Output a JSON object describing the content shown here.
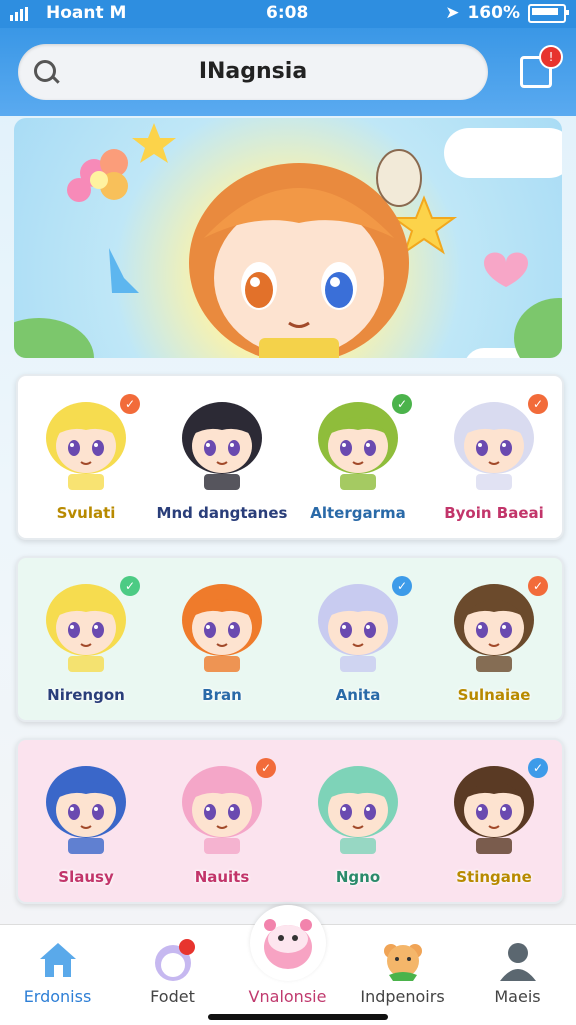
{
  "status_bar": {
    "carrier": "Hoant M",
    "time": "6:08",
    "battery": "160%"
  },
  "header": {
    "title": "INagnsia",
    "notification_count": "!"
  },
  "rows": [
    {
      "bg": "#ffffff",
      "characters": [
        {
          "name": "Svulati",
          "hair": "#f6dc4f",
          "name_color": "#b88a00",
          "badge": "#f26b3a"
        },
        {
          "name": "Mnd dangtanes",
          "hair": "#2c2a35",
          "name_color": "#2a3e7a",
          "badge": ""
        },
        {
          "name": "Altergarma",
          "hair": "#8fbd3b",
          "name_color": "#2a6aa8",
          "badge": "#4bb34b"
        },
        {
          "name": "Byoin Baeai",
          "hair": "#d9dbf0",
          "name_color": "#c2356a",
          "badge": "#f26b3a"
        }
      ]
    },
    {
      "bg": "#eaf8f2",
      "characters": [
        {
          "name": "Nirengon",
          "hair": "#f6dc4f",
          "name_color": "#2a3e7a",
          "badge": "#4ccb84"
        },
        {
          "name": "Bran",
          "hair": "#ef7b2b",
          "name_color": "#2a6aa8",
          "badge": ""
        },
        {
          "name": "Anita",
          "hair": "#c8cbf0",
          "name_color": "#2a6aa8",
          "badge": "#3d9be9"
        },
        {
          "name": "Sulnaiae",
          "hair": "#6b4a2c",
          "name_color": "#b88a00",
          "badge": "#f26b3a"
        }
      ]
    },
    {
      "bg": "#fbe3ee",
      "characters": [
        {
          "name": "Slausy",
          "hair": "#3a67c9",
          "name_color": "#c2356a",
          "badge": ""
        },
        {
          "name": "Nauits",
          "hair": "#f4a6c8",
          "name_color": "#c2356a",
          "badge": "#f26b3a"
        },
        {
          "name": "Ngno",
          "hair": "#7ed3b8",
          "name_color": "#2a8a6a",
          "badge": ""
        },
        {
          "name": "Stingane",
          "hair": "#5a3a24",
          "name_color": "#b88a00",
          "badge": "#3d9be9"
        }
      ]
    }
  ],
  "tabs": [
    {
      "label": "Erdoniss",
      "icon": "home-icon"
    },
    {
      "label": "Fodet",
      "icon": "cat-icon"
    },
    {
      "label": "Vnalonsie",
      "icon": "pet-icon"
    },
    {
      "label": "Indpenoirs",
      "icon": "bear-icon"
    },
    {
      "label": "Maeis",
      "icon": "user-icon"
    }
  ]
}
